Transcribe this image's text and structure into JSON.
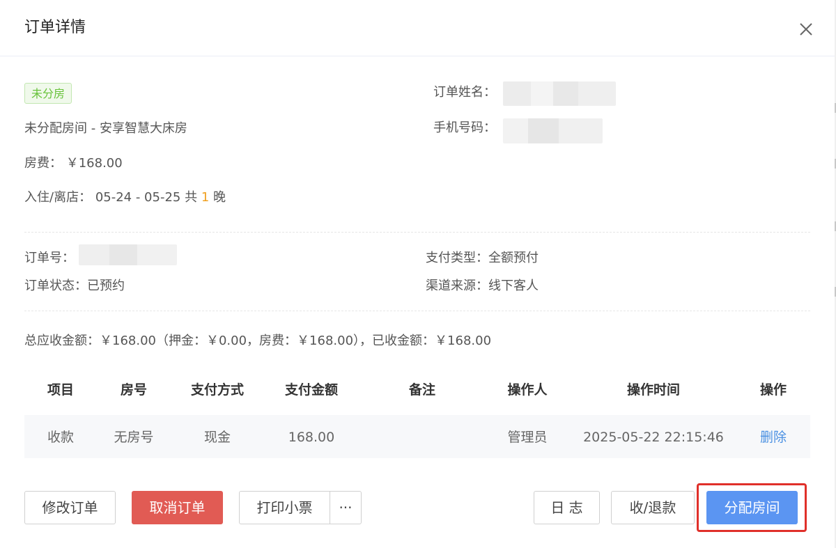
{
  "dialog": {
    "title": "订单详情"
  },
  "room": {
    "status_tag": "未分房",
    "room_info": "未分配房间 - 安享智慧大床房",
    "fee_label": "房费：",
    "fee_value": "￥168.00",
    "stay_label": "入住/离店：",
    "stay_dates": "05-24 - 05-25 共",
    "nights": "1",
    "nights_unit": "晚"
  },
  "guest": {
    "name_label": "订单姓名：",
    "phone_label": "手机号码："
  },
  "order": {
    "number_label": "订单号：",
    "status_label": "订单状态：",
    "status_value": "已预约",
    "pay_type_label": "支付类型：",
    "pay_type_value": "全额预付",
    "channel_label": "渠道来源：",
    "channel_value": "线下客人"
  },
  "summary": "总应收金额：￥168.00（押金：￥0.00，房费：￥168.00），已收金额：￥168.00",
  "payments": {
    "columns": [
      "项目",
      "房号",
      "支付方式",
      "支付金额",
      "备注",
      "操作人",
      "操作时间",
      "操作"
    ],
    "rows": [
      {
        "item": "收款",
        "room": "无房号",
        "method": "现金",
        "amount": "168.00",
        "note": "",
        "operator": "管理员",
        "time": "2025-05-22 22:15:46",
        "action": "删除"
      }
    ]
  },
  "footer": {
    "modify": "修改订单",
    "cancel": "取消订单",
    "print": "打印小票",
    "more": "···",
    "log": "日 志",
    "refund": "收/退款",
    "assign": "分配房间"
  },
  "colors": {
    "primary": "#5b95f2",
    "danger": "#e15b54",
    "success": "#67c23a",
    "highlight": "#f0a020",
    "annotation": "#e0302a"
  },
  "icons": {
    "close": "close-icon"
  }
}
